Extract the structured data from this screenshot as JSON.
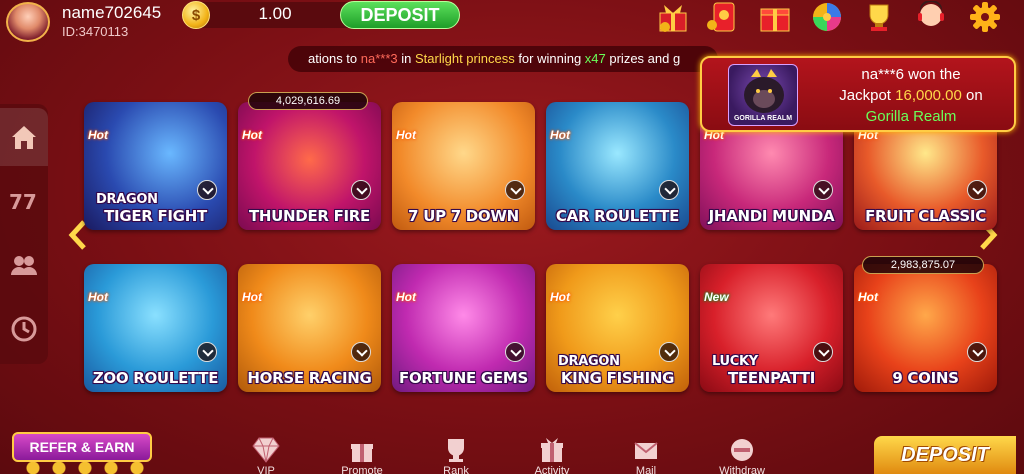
{
  "user": {
    "name": "name702645",
    "id": "ID:3470113",
    "balance": "1.00"
  },
  "header": {
    "coin_symbol": "$",
    "deposit_label": "DEPOSIT"
  },
  "marquee": {
    "prefix": "ations to ",
    "player": "na***3",
    "mid": " in ",
    "game": "Starlight princess",
    "mid2": " for winning ",
    "mult": "x47",
    "suffix": " prizes and g"
  },
  "jackpot": {
    "player_line": "na***6 won the",
    "jackpot_word": "Jackpot ",
    "amount": "16,000.00",
    "on_word": " on",
    "game": "Gorilla Realm",
    "thumb_caption": "GORILLA REALM"
  },
  "games_row1": [
    {
      "line1": "DRAGON",
      "line2": "TIGER  FIGHT",
      "badge": "Hot"
    },
    {
      "line1": "",
      "line2": "THUNDER FIRE",
      "badge": "Hot",
      "pill": "4,029,616.69"
    },
    {
      "line1": "",
      "line2": "7 UP 7 DOWN",
      "badge": "Hot"
    },
    {
      "line1": "",
      "line2": "CAR ROULETTE",
      "badge": "Hot"
    },
    {
      "line1": "",
      "line2": "JHANDI MUNDA",
      "badge": "Hot"
    },
    {
      "line1": "",
      "line2": "FRUIT CLASSIC",
      "badge": "Hot"
    }
  ],
  "games_row2": [
    {
      "line1": "",
      "line2": "ZOO ROULETTE",
      "badge": "Hot"
    },
    {
      "line1": "",
      "line2": "HORSE RACING",
      "badge": "Hot"
    },
    {
      "line1": "",
      "line2": "FORTUNE GEMS",
      "badge": "Hot"
    },
    {
      "line1": "DRAGON",
      "line2": "KING FISHING",
      "badge": "Hot"
    },
    {
      "line1": "LUCKY",
      "line2": "TEENPATTI",
      "badge": "New"
    },
    {
      "line1": "",
      "line2": "9 COINS",
      "badge": "Hot",
      "pill": "2,983,875.07"
    }
  ],
  "bottom_nav": {
    "refer_label": "REFER & EARN",
    "items": [
      "VIP",
      "Promote",
      "Rank",
      "Activity",
      "Mail",
      "Withdraw"
    ],
    "deposit_label": "DEPOSIT"
  },
  "colors": {
    "background": "#7a0f14",
    "deposit_green": "#1e9e28",
    "accent_gold": "#ffcc44"
  }
}
